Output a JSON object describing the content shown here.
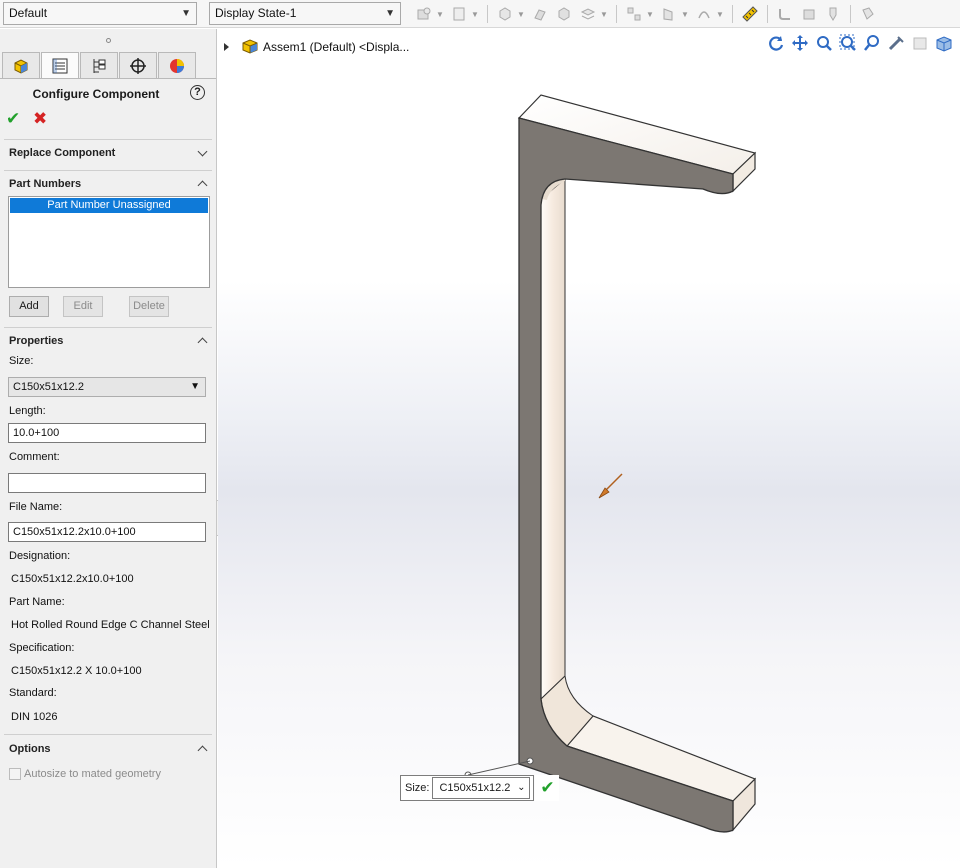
{
  "toolbar": {
    "configuration": "Default",
    "display_state": "Display State-1"
  },
  "panel": {
    "tabs": [
      "feature-manager",
      "property-manager",
      "configuration-manager",
      "dimxpert-manager",
      "display-manager"
    ],
    "title": "Configure Component",
    "help_glyph": "?",
    "ok_glyph": "✔",
    "cancel_glyph": "✖",
    "sections": {
      "replace": "Replace Component",
      "part_numbers": "Part Numbers",
      "properties": "Properties",
      "options": "Options"
    },
    "part_numbers": {
      "selected_item": "Part Number Unassigned",
      "add": "Add",
      "edit": "Edit",
      "delete": "Delete"
    },
    "properties": {
      "size_label": "Size:",
      "size_value": "C150x51x12.2",
      "length_label": "Length:",
      "length_value": "10.0+100",
      "comment_label": "Comment:",
      "comment_value": "",
      "file_name_label": "File Name:",
      "file_name_value": "C150x51x12.2x10.0+100",
      "designation_label": "Designation:",
      "designation_value": "C150x51x12.2x10.0+100",
      "part_name_label": "Part Name:",
      "part_name_value": "Hot Rolled Round Edge C Channel Steel",
      "specification_label": "Specification:",
      "specification_value": "C150x51x12.2 X 10.0+100",
      "standard_label": "Standard:",
      "standard_value": "DIN 1026"
    },
    "options": {
      "autosize_label": "Autosize to mated geometry",
      "autosize_checked": false
    }
  },
  "viewport": {
    "tree_label": "Assem1 (Default) <Displa...",
    "callout": {
      "label": "Size:",
      "value": "C150x51x12.2",
      "ok_glyph": "✔"
    }
  },
  "colors": {
    "selection": "#0f7ad8",
    "ok": "#22a12c",
    "cancel": "#d52323",
    "steel_face": "#7c7772",
    "steel_light": "#f6efe8"
  }
}
